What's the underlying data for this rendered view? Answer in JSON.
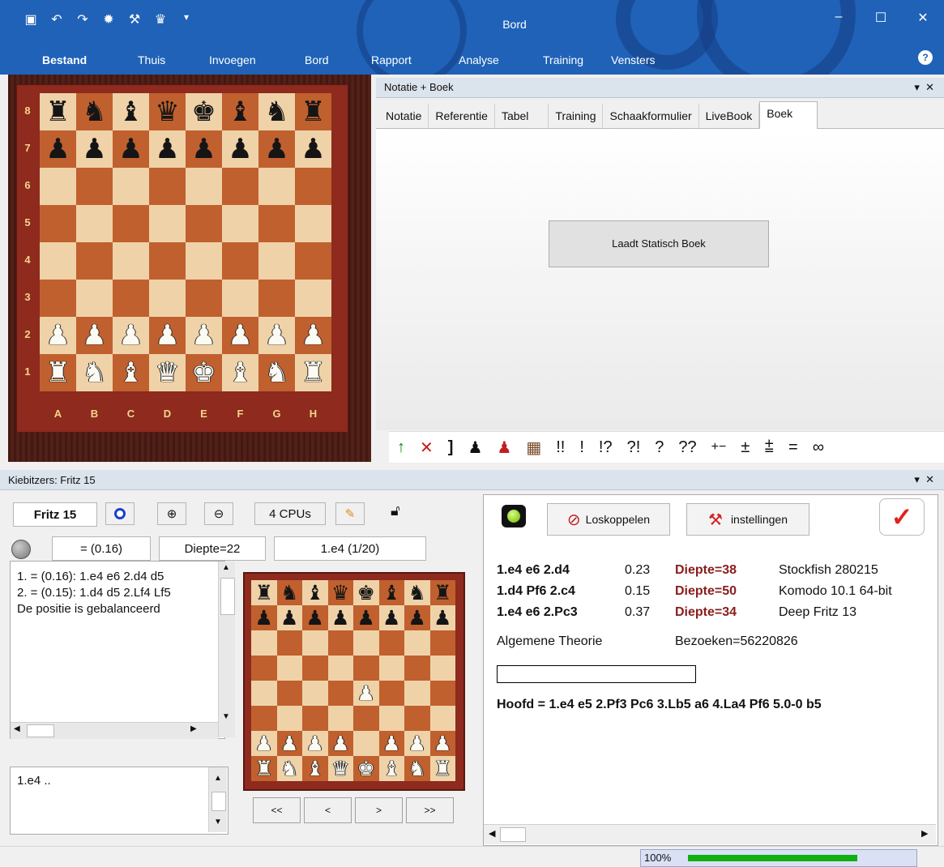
{
  "window": {
    "title": "Bord",
    "minimize": "‒",
    "maximize": "☐",
    "close": "✕"
  },
  "quick_access": [
    "save-icon",
    "undo-icon",
    "redo-icon",
    "engine-icon",
    "wrench-icon",
    "bulb-icon",
    "dropdown-icon"
  ],
  "menu": [
    "Bestand",
    "Thuis",
    "Invoegen",
    "Bord",
    "Rapport",
    "Analyse",
    "Training",
    "Vensters"
  ],
  "board": {
    "ranks": [
      "8",
      "7",
      "6",
      "5",
      "4",
      "3",
      "2",
      "1"
    ],
    "files": [
      "A",
      "B",
      "C",
      "D",
      "E",
      "F",
      "G",
      "H"
    ],
    "position": [
      "rnbqkbnr",
      "pppppppp",
      "8",
      "8",
      "8",
      "8",
      "PPPPPPPP",
      "RNBQKBNR"
    ]
  },
  "notation": {
    "title": "Notatie + Boek",
    "tabs": [
      "Notatie",
      "Referentie",
      "Tabel",
      "Training",
      "Schaakformulier",
      "LiveBook",
      "Boek"
    ],
    "active_tab": "Boek",
    "load_button": "Laadt Statisch Boek",
    "symbols": [
      "↑",
      "✕",
      "]",
      "♟",
      "♟",
      "▦",
      "!!",
      "!",
      "!?",
      "?!",
      "?",
      "??",
      "+−",
      "±",
      "⩲",
      "=",
      "∞"
    ]
  },
  "kibitzer": {
    "title": "Kiebitzers: Fritz 15",
    "engine_name": "Fritz 15",
    "cpus": "4 CPUs",
    "eval": "= (0.16)",
    "depth": "Diepte=22",
    "current_move": "1.e4 (1/20)",
    "lines": [
      "1. = (0.16): 1.e4 e6 2.d4 d5",
      "2. = (0.15): 1.d4 d5 2.Lf4 Lf5",
      "De positie is gebalanceerd"
    ],
    "moves": "1.e4 ..",
    "mini_position": [
      "rnbqkbnr",
      "pppppppp",
      "8",
      "8",
      "4P3",
      "8",
      "PPPP1PPP",
      "RNBQKBNR"
    ],
    "nav": [
      "<<",
      "<",
      ">",
      ">>"
    ]
  },
  "book": {
    "disconnect": "Loskoppelen",
    "settings": "instellingen",
    "rows": [
      {
        "moves": "1.e4 e6 2.d4",
        "score": "0.23",
        "depth": "Diepte=38",
        "engine": "Stockfish 280215"
      },
      {
        "moves": "1.d4 Pf6 2.c4",
        "score": "0.15",
        "depth": "Diepte=50",
        "engine": "Komodo 10.1 64-bit"
      },
      {
        "moves": "1.e4 e6 2.Pc3",
        "score": "0.37",
        "depth": "Diepte=34",
        "engine": "Deep Fritz 13"
      }
    ],
    "theory": "Algemene Theorie",
    "visits": "Bezoeken=56220826",
    "main_line": "Hoofd = 1.e4 e5 2.Pf3 Pc6 3.Lb5 a6 4.La4 Pf6 5.0-0 b5"
  },
  "status": {
    "zoom": "100%",
    "zoom_progress": 0.79
  },
  "colors": {
    "ribbon": "#1f62b8",
    "dark_square": "#c0602e",
    "light_square": "#f0d2a8",
    "depth": "#8b1c1c"
  }
}
